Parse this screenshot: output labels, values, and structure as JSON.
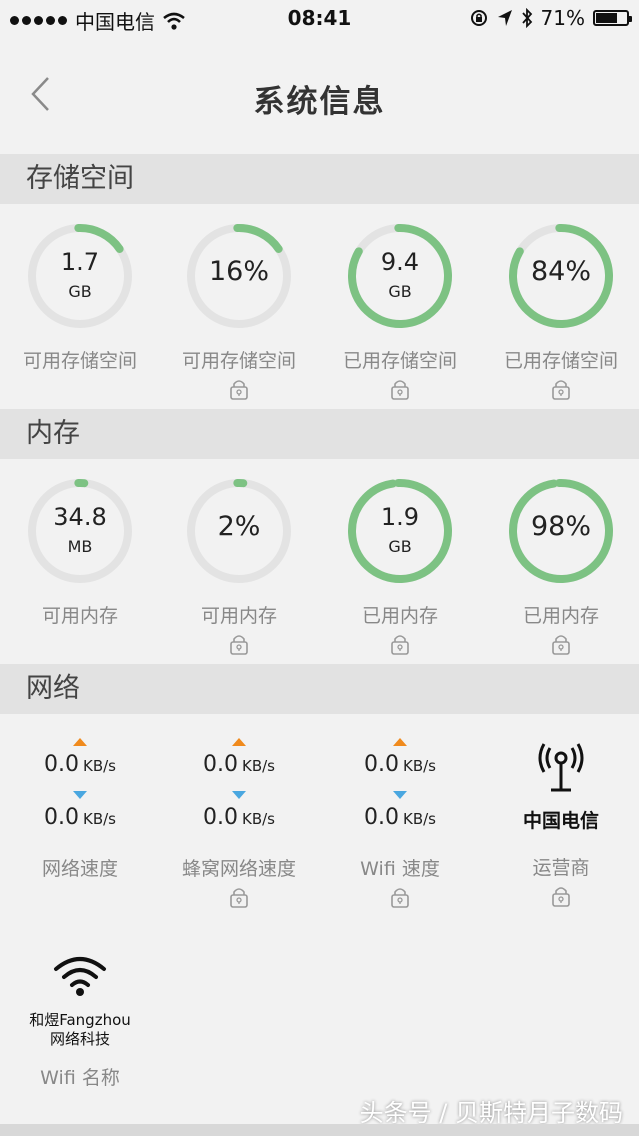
{
  "status_bar": {
    "carrier": "中国电信",
    "time": "08:41",
    "battery": "71%",
    "battery_level": 0.71
  },
  "nav": {
    "title": "系统信息"
  },
  "colors": {
    "ring_fill": "#7dc283",
    "ring_track": "#e3e3e3",
    "upload": "#f08a1c",
    "download": "#4aa7e0"
  },
  "storage": {
    "header": "存储空间",
    "items": [
      {
        "value": "1.7",
        "unit": "GB",
        "label": "可用存储空间",
        "fraction": 0.16,
        "locked": false
      },
      {
        "value": "16%",
        "unit": "",
        "label": "可用存储空间",
        "fraction": 0.16,
        "locked": true
      },
      {
        "value": "9.4",
        "unit": "GB",
        "label": "已用存储空间",
        "fraction": 0.84,
        "locked": true
      },
      {
        "value": "84%",
        "unit": "",
        "label": "已用存储空间",
        "fraction": 0.84,
        "locked": true
      }
    ]
  },
  "memory": {
    "header": "内存",
    "items": [
      {
        "value": "34.8",
        "unit": "MB",
        "label": "可用内存",
        "fraction": 0.02,
        "locked": false
      },
      {
        "value": "2%",
        "unit": "",
        "label": "可用内存",
        "fraction": 0.02,
        "locked": true
      },
      {
        "value": "1.9",
        "unit": "GB",
        "label": "已用内存",
        "fraction": 0.98,
        "locked": true
      },
      {
        "value": "98%",
        "unit": "",
        "label": "已用内存",
        "fraction": 0.98,
        "locked": true
      }
    ]
  },
  "network": {
    "header": "网络",
    "items": [
      {
        "up": "0.0",
        "down": "0.0",
        "unit": "KB/s",
        "label": "网络速度",
        "locked": false
      },
      {
        "up": "0.0",
        "down": "0.0",
        "unit": "KB/s",
        "label": "蜂窝网络速度",
        "locked": true
      },
      {
        "up": "0.0",
        "down": "0.0",
        "unit": "KB/s",
        "label": "Wifi 速度",
        "locked": true
      }
    ],
    "carrier": {
      "name": "中国电信",
      "label": "运营商",
      "locked": true
    },
    "wifi": {
      "name_line1": "和煜Fangzhou",
      "name_line2": "网络科技",
      "label": "Wifi 名称"
    }
  },
  "watermark": "头条号 / 贝斯特月子数码"
}
